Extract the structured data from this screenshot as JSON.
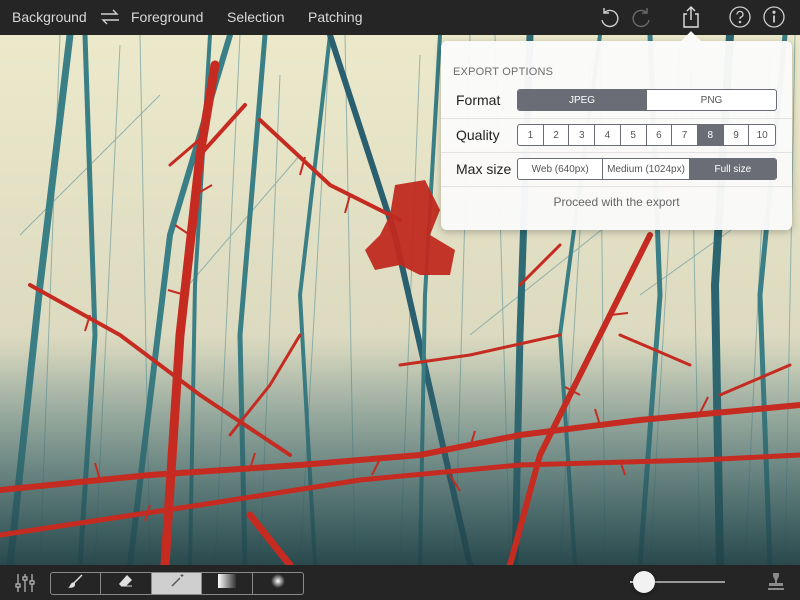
{
  "topbar": {
    "tabs": [
      "Background",
      "Foreground",
      "Selection",
      "Patching"
    ],
    "icons": [
      "undo-icon",
      "redo-icon",
      "share-icon",
      "help-icon",
      "info-icon"
    ]
  },
  "export": {
    "heading": "EXPORT OPTIONS",
    "format": {
      "label": "Format",
      "options": [
        "JPEG",
        "PNG"
      ],
      "selected": "JPEG"
    },
    "quality": {
      "label": "Quality",
      "options": [
        "1",
        "2",
        "3",
        "4",
        "5",
        "6",
        "7",
        "8",
        "9",
        "10"
      ],
      "selected": "8"
    },
    "max_size": {
      "label": "Max size",
      "options": [
        "Web (640px)",
        "Medium (1024px)",
        "Full size"
      ],
      "selected": "Full size"
    },
    "proceed_label": "Proceed with the export"
  },
  "toolbar": {
    "tools": [
      "brush-icon",
      "eraser-icon",
      "magic-wand-icon",
      "gradient-icon",
      "radial-icon"
    ],
    "selected_tool": "magic-wand-icon",
    "brush_size": 0.15
  },
  "colors": {
    "bar_bg": "#252525",
    "segment_selected": "#6a6d75",
    "sky": "#e9e6c8",
    "branch_teal": "#3d8289",
    "thorn_red": "#c0281e"
  }
}
